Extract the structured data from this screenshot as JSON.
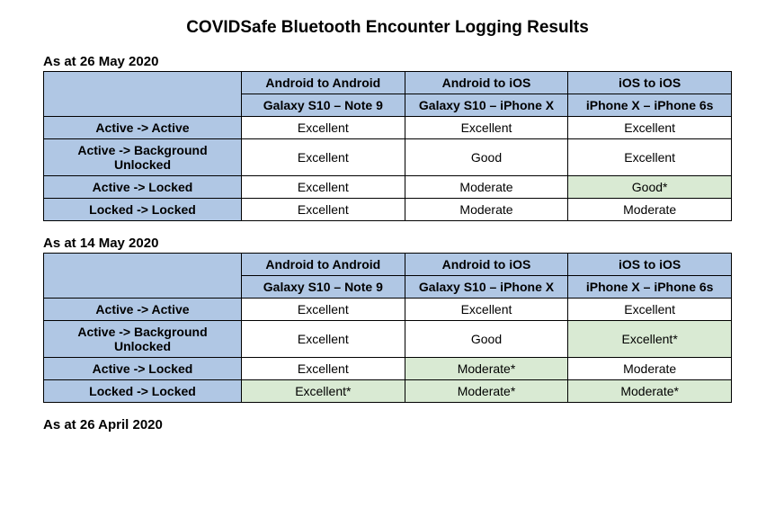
{
  "title": "COVIDSafe Bluetooth Encounter Logging Results",
  "sections": [
    {
      "date": "As at 26 May 2020",
      "header1": [
        "Android to Android",
        "Android to iOS",
        "iOS to iOS"
      ],
      "header2": [
        "Galaxy S10 – Note 9",
        "Galaxy S10 – iPhone X",
        "iPhone X – iPhone 6s"
      ],
      "rows": [
        {
          "label": "Active -> Active",
          "cells": [
            {
              "v": "Excellent"
            },
            {
              "v": "Excellent"
            },
            {
              "v": "Excellent"
            }
          ]
        },
        {
          "label": "Active -> Background Unlocked",
          "cells": [
            {
              "v": "Excellent"
            },
            {
              "v": "Good"
            },
            {
              "v": "Excellent"
            }
          ]
        },
        {
          "label": "Active -> Locked",
          "cells": [
            {
              "v": "Excellent"
            },
            {
              "v": "Moderate"
            },
            {
              "v": "Good*",
              "hl": true
            }
          ]
        },
        {
          "label": "Locked -> Locked",
          "cells": [
            {
              "v": "Excellent"
            },
            {
              "v": "Moderate"
            },
            {
              "v": "Moderate"
            }
          ]
        }
      ]
    },
    {
      "date": "As at 14 May 2020",
      "header1": [
        "Android to Android",
        "Android to iOS",
        "iOS to iOS"
      ],
      "header2": [
        "Galaxy S10 – Note 9",
        "Galaxy S10 – iPhone X",
        "iPhone X – iPhone 6s"
      ],
      "rows": [
        {
          "label": "Active -> Active",
          "cells": [
            {
              "v": "Excellent"
            },
            {
              "v": "Excellent"
            },
            {
              "v": "Excellent"
            }
          ]
        },
        {
          "label": "Active -> Background Unlocked",
          "cells": [
            {
              "v": "Excellent"
            },
            {
              "v": "Good"
            },
            {
              "v": "Excellent*",
              "hl": true
            }
          ]
        },
        {
          "label": "Active -> Locked",
          "cells": [
            {
              "v": "Excellent"
            },
            {
              "v": "Moderate*",
              "hl": true
            },
            {
              "v": "Moderate"
            }
          ]
        },
        {
          "label": "Locked -> Locked",
          "cells": [
            {
              "v": "Excellent*",
              "hl": true
            },
            {
              "v": "Moderate*",
              "hl": true
            },
            {
              "v": "Moderate*",
              "hl": true
            }
          ]
        }
      ]
    },
    {
      "date": "As at 26 April 2020"
    }
  ]
}
